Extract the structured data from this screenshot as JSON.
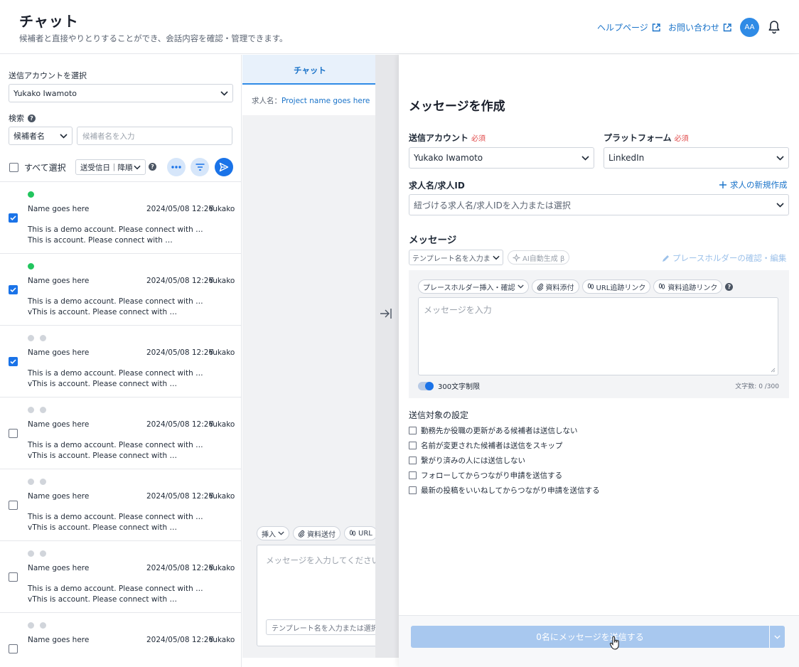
{
  "header": {
    "title": "チャット",
    "subtitle": "候補者と直接やりとりすることができ、会話内容を確認・管理できます。",
    "help_link": "ヘルプページ",
    "contact_link": "お問い合わせ",
    "avatar_initials": "AA"
  },
  "left": {
    "account_label": "送信アカウントを選択",
    "account_value": "Yukako Iwamoto",
    "search_label": "検索",
    "search_type": "候補者名",
    "search_placeholder": "候補者名を入力",
    "select_all": "すべて選択",
    "sort_value": "送受信日｜降順",
    "items": [
      {
        "name": "Name goes here",
        "date": "2024/05/08  12:26",
        "owner": "Yukako",
        "preview": "This is a demo account. Please connect with … This is account. Please connect with …",
        "checked": true,
        "status": "online"
      },
      {
        "name": "Name goes here",
        "date": "2024/05/08  12:26",
        "owner": "Yukako",
        "preview": "This is a demo account. Please connect with …vThis is account. Please connect with …",
        "checked": true,
        "status": "online"
      },
      {
        "name": "Name goes here",
        "date": "2024/05/08  12:26",
        "owner": "Yukako",
        "preview": "This is a demo account. Please connect with …vThis is account. Please connect with …",
        "checked": true,
        "status": "offline"
      },
      {
        "name": "Name goes here",
        "date": "2024/05/08  12:26",
        "owner": "Yukako",
        "preview": "This is a demo account. Please connect with …vThis is account. Please connect with …",
        "checked": false,
        "status": "offline"
      },
      {
        "name": "Name goes here",
        "date": "2024/05/08  12:26",
        "owner": "Yukako",
        "preview": "This is a demo account. Please connect with …vThis is account. Please connect with …",
        "checked": false,
        "status": "offline"
      },
      {
        "name": "Name goes here",
        "date": "2024/05/08  12:26",
        "owner": "Yukako",
        "preview": "This is a demo account. Please connect with …vThis is account. Please connect with …",
        "checked": false,
        "status": "offline"
      },
      {
        "name": "Name goes here",
        "date": "2024/05/08  12:26",
        "owner": "Yukako",
        "preview": "",
        "checked": false,
        "status": "offline"
      }
    ]
  },
  "middle": {
    "tab_label": "チャット",
    "job_label": "求人名：",
    "job_value": "Project name goes here",
    "insert_chip": "挿入",
    "attach_chip": "資料送付",
    "url_chip": "URL",
    "message_placeholder": "メッセージを入力してください",
    "template_placeholder": "テンプレート名を入力または選択"
  },
  "drawer": {
    "title": "メッセージを作成",
    "account_label": "送信アカウント",
    "required": "必須",
    "account_value": "Yukako Iwamoto",
    "platform_label": "プラットフォーム",
    "platform_value": "LinkedIn",
    "job_label": "求人名/求人ID",
    "new_job_link": "求人の新規作成",
    "job_placeholder": "紐づける求人名/求人IDを入力または選択",
    "message_label": "メッセージ",
    "template_placeholder": "テンプレート名を入力または選択",
    "ai_button": "AI自動生成 β",
    "placeholder_link": "プレースホルダーの確認・編集",
    "chip_placeholder": "プレースホルダー挿入・確認",
    "chip_attach": "資料添付",
    "chip_url": "URL追跡リンク",
    "chip_doc": "資料追跡リンク",
    "message_placeholder": "メッセージを入力",
    "limit_label": "300文字制限",
    "char_count": "文字数: 0 /300",
    "target_title": "送信対象の設定",
    "options": [
      "勤務先か役職の更新がある候補者は送信しない",
      "名前が変更された候補者は送信をスキップ",
      "繋がり済みの人には送信しない",
      "フォローしてからつながり申請を送信する",
      "最新の投稿をいいねしてからつながり申請を送信する"
    ],
    "send_button": "0名にメッセージを送信する"
  },
  "colors": {
    "accent": "#1a73e8",
    "online": "#22c55e",
    "offline": "#d1d5db",
    "send_disabled": "#a8c8ef"
  }
}
